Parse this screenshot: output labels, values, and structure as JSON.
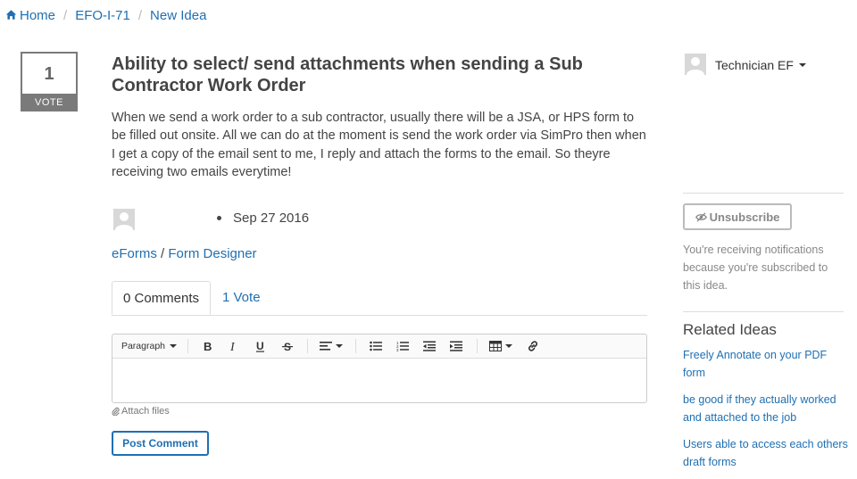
{
  "breadcrumb": {
    "home": "Home",
    "project": "EFO-I-71",
    "current": "New Idea"
  },
  "vote": {
    "count": "1",
    "label": "VOTE"
  },
  "idea": {
    "title": "Ability to select/ send attachments when sending a Sub Contractor Work Order",
    "description": "When we send a work order to a sub contractor, usually there will be a JSA, or HPS form to be filled out onsite. All we can do at the moment is send the work order via SimPro then when I get a copy of the email sent to me, I reply and attach the forms to the email. So theyre receiving two emails everytime!",
    "date": "Sep 27 2016",
    "category": "eForms",
    "category_sep": " / ",
    "subcategory": "Form Designer"
  },
  "tabs": [
    {
      "label": "0 Comments"
    },
    {
      "label": "1 Vote"
    }
  ],
  "editor": {
    "paragraph_label": "Paragraph",
    "attach_label": "Attach files",
    "post_label": "Post Comment"
  },
  "user": {
    "name": "Technician EF"
  },
  "subscription": {
    "button_label": "Unsubscribe",
    "notice": "You're receiving notifications because you're subscribed to this idea."
  },
  "related": {
    "heading": "Related Ideas",
    "items": [
      {
        "label": "Freely Annotate on your PDF form"
      },
      {
        "label": "be good if they actually worked and attached to the job"
      },
      {
        "label": "Users able to access each others draft forms"
      }
    ]
  },
  "colors": {
    "link": "#1f6fb2",
    "vote_border": "#7a7a7a",
    "muted": "#888888"
  }
}
